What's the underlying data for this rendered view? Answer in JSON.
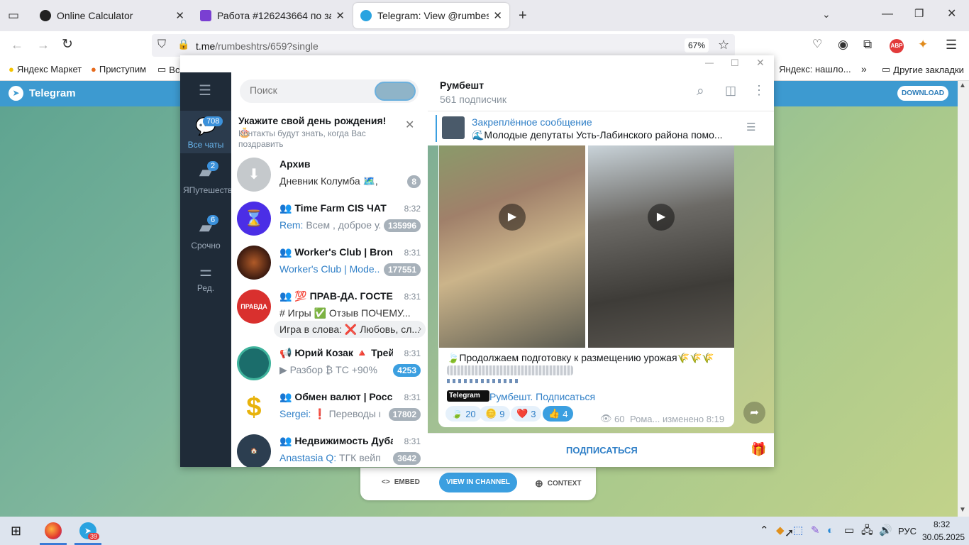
{
  "tabs": [
    {
      "title": "Online Calculator",
      "color": "#222"
    },
    {
      "title": "Работа #126243664 по заказу",
      "color": "#7a3fd2"
    },
    {
      "title": "Telegram: View @rumbeshtrs",
      "color": "#2aa3e0"
    }
  ],
  "address": {
    "url_host": "t.me",
    "url_path": "/rumbeshtrs/659?single",
    "zoom": "67%"
  },
  "bookmarks": {
    "b1": "Яндекс Маркет",
    "b2": "Приступим",
    "b3": "Вс",
    "b4": "Яндекс: нашло...",
    "b5": "Другие закладки"
  },
  "tg_header": {
    "brand": "Telegram",
    "download": "DOWNLOAD"
  },
  "bottom_buttons": {
    "embed": "EMBED",
    "view": "VIEW IN CHANNEL",
    "context": "CONTEXT"
  },
  "rail": [
    {
      "label": "Все чаты",
      "badge": "708"
    },
    {
      "label": "ЯПутешествия",
      "badge": "2"
    },
    {
      "label": "Срочно",
      "badge": "6"
    },
    {
      "label": "Ред.",
      "badge": ""
    }
  ],
  "search": {
    "placeholder": "Поиск"
  },
  "birthday": {
    "title": "Укажите свой день рождения! 🎂",
    "text": "Контакты будут знать, когда Вас поздравить"
  },
  "chats": [
    {
      "name": "Архив",
      "time": "",
      "sender": "",
      "preview": "Дневник Колумба 🗺️, Кл...",
      "badge": "8",
      "blue": false,
      "av": "#c5c9cc"
    },
    {
      "name": "👥 Time Farm CIS ЧАТ",
      "time": "8:32",
      "sender": "Rem:",
      "preview": " Всем , доброе у...",
      "badge": "135996",
      "blue": false,
      "av": "#4b2ee6"
    },
    {
      "name": "👥 Worker's Club | Bronze",
      "time": "8:31",
      "sender": "Worker's Club | Mode...",
      "preview": "",
      "badge": "177551",
      "blue": false,
      "av": "#3a1a10"
    },
    {
      "name": "👥 💯 ПРАВ-ДА. ГОСТЕ...",
      "time": "8:31",
      "sender": "",
      "preview": "# Игры  ✅ Отзыв ПОЧЕМУ...",
      "badge": "",
      "blue": false,
      "av": "#d9302e"
    },
    {
      "name": "📢 Юрий Козак 🔺 Трей...",
      "time": "8:31",
      "sender": "",
      "preview": "▶ Разбор ₿ ТС +90% ...",
      "badge": "4253",
      "blue": true,
      "av": "#1b6d6b"
    },
    {
      "name": "👥 Обмен валют | Росси...",
      "time": "8:31",
      "sender": "Sergei:",
      "preview": " ❗ Переводы и...",
      "badge": "17802",
      "blue": false,
      "av": "#f5f5f5"
    },
    {
      "name": "👥 Недвижимость Дубай",
      "time": "8:31",
      "sender": "Anastasia Q:",
      "preview": " ТГК вейп и...",
      "badge": "3642",
      "blue": false,
      "av": "#2c3e50"
    }
  ],
  "sub_row": "Игра в слова: ❌ Любовь, сл...",
  "channel": {
    "name": "Румбешт",
    "subs": "561 подписчик"
  },
  "pinned": {
    "label": "Закреплённое сообщение",
    "text": "🌊Молодые депутаты Усть-Лабинского района помо..."
  },
  "post": {
    "text": "🍃Продолжаем подготовку к размещению урожая🌾🌾🌾",
    "tg_badge": "Telegram",
    "link": "Румбешт. Подписаться",
    "views": "60",
    "meta": "Рома... изменено 8:19"
  },
  "reactions": [
    {
      "emoji": "🍃",
      "count": "20"
    },
    {
      "emoji": "🪙",
      "count": "9"
    },
    {
      "emoji": "❤️",
      "count": "3"
    },
    {
      "emoji": "👍",
      "count": "4"
    }
  ],
  "subscribe": "ПОДПИСАТЬСЯ",
  "taskbar": {
    "lang": "РУС",
    "time": "8:32",
    "date": "30.05.2025",
    "tg_badge": "39"
  }
}
